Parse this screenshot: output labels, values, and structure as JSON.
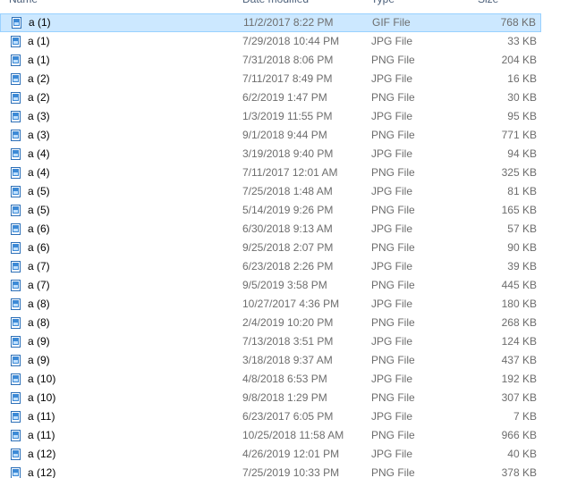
{
  "columns": {
    "name": "Name",
    "date": "Date modified",
    "type": "Type",
    "size": "Size"
  },
  "icon": "image-file-icon",
  "colors": {
    "selection": "#cce8ff",
    "selection_border": "#99d1ff",
    "secondary_text": "#6d6d6d"
  },
  "files": [
    {
      "name": "a (1)",
      "date": "11/2/2017 8:22 PM",
      "type": "GIF File",
      "size": "768 KB",
      "selected": true
    },
    {
      "name": "a (1)",
      "date": "7/29/2018 10:44 PM",
      "type": "JPG File",
      "size": "33 KB"
    },
    {
      "name": "a (1)",
      "date": "7/31/2018 8:06 PM",
      "type": "PNG File",
      "size": "204 KB"
    },
    {
      "name": "a (2)",
      "date": "7/11/2017 8:49 PM",
      "type": "JPG File",
      "size": "16 KB"
    },
    {
      "name": "a (2)",
      "date": "6/2/2019 1:47 PM",
      "type": "PNG File",
      "size": "30 KB"
    },
    {
      "name": "a (3)",
      "date": "1/3/2019 11:55 PM",
      "type": "JPG File",
      "size": "95 KB"
    },
    {
      "name": "a (3)",
      "date": "9/1/2018 9:44 PM",
      "type": "PNG File",
      "size": "771 KB"
    },
    {
      "name": "a (4)",
      "date": "3/19/2018 9:40 PM",
      "type": "JPG File",
      "size": "94 KB"
    },
    {
      "name": "a (4)",
      "date": "7/11/2017 12:01 AM",
      "type": "PNG File",
      "size": "325 KB"
    },
    {
      "name": "a (5)",
      "date": "7/25/2018 1:48 AM",
      "type": "JPG File",
      "size": "81 KB"
    },
    {
      "name": "a (5)",
      "date": "5/14/2019 9:26 PM",
      "type": "PNG File",
      "size": "165 KB"
    },
    {
      "name": "a (6)",
      "date": "6/30/2018 9:13 AM",
      "type": "JPG File",
      "size": "57 KB"
    },
    {
      "name": "a (6)",
      "date": "9/25/2018 2:07 PM",
      "type": "PNG File",
      "size": "90 KB"
    },
    {
      "name": "a (7)",
      "date": "6/23/2018 2:26 PM",
      "type": "JPG File",
      "size": "39 KB"
    },
    {
      "name": "a (7)",
      "date": "9/5/2019 3:58 PM",
      "type": "PNG File",
      "size": "445 KB"
    },
    {
      "name": "a (8)",
      "date": "10/27/2017 4:36 PM",
      "type": "JPG File",
      "size": "180 KB"
    },
    {
      "name": "a (8)",
      "date": "2/4/2019 10:20 PM",
      "type": "PNG File",
      "size": "268 KB"
    },
    {
      "name": "a (9)",
      "date": "7/13/2018 3:51 PM",
      "type": "JPG File",
      "size": "124 KB"
    },
    {
      "name": "a (9)",
      "date": "3/18/2018 9:37 AM",
      "type": "PNG File",
      "size": "437 KB"
    },
    {
      "name": "a (10)",
      "date": "4/8/2018 6:53 PM",
      "type": "JPG File",
      "size": "192 KB"
    },
    {
      "name": "a (10)",
      "date": "9/8/2018 1:29 PM",
      "type": "PNG File",
      "size": "307 KB"
    },
    {
      "name": "a (11)",
      "date": "6/23/2017 6:05 PM",
      "type": "JPG File",
      "size": "7 KB"
    },
    {
      "name": "a (11)",
      "date": "10/25/2018 11:58 AM",
      "type": "PNG File",
      "size": "966 KB"
    },
    {
      "name": "a (12)",
      "date": "4/26/2019 12:01 PM",
      "type": "JPG File",
      "size": "40 KB"
    },
    {
      "name": "a (12)",
      "date": "7/25/2019 10:33 PM",
      "type": "PNG File",
      "size": "378 KB"
    }
  ]
}
